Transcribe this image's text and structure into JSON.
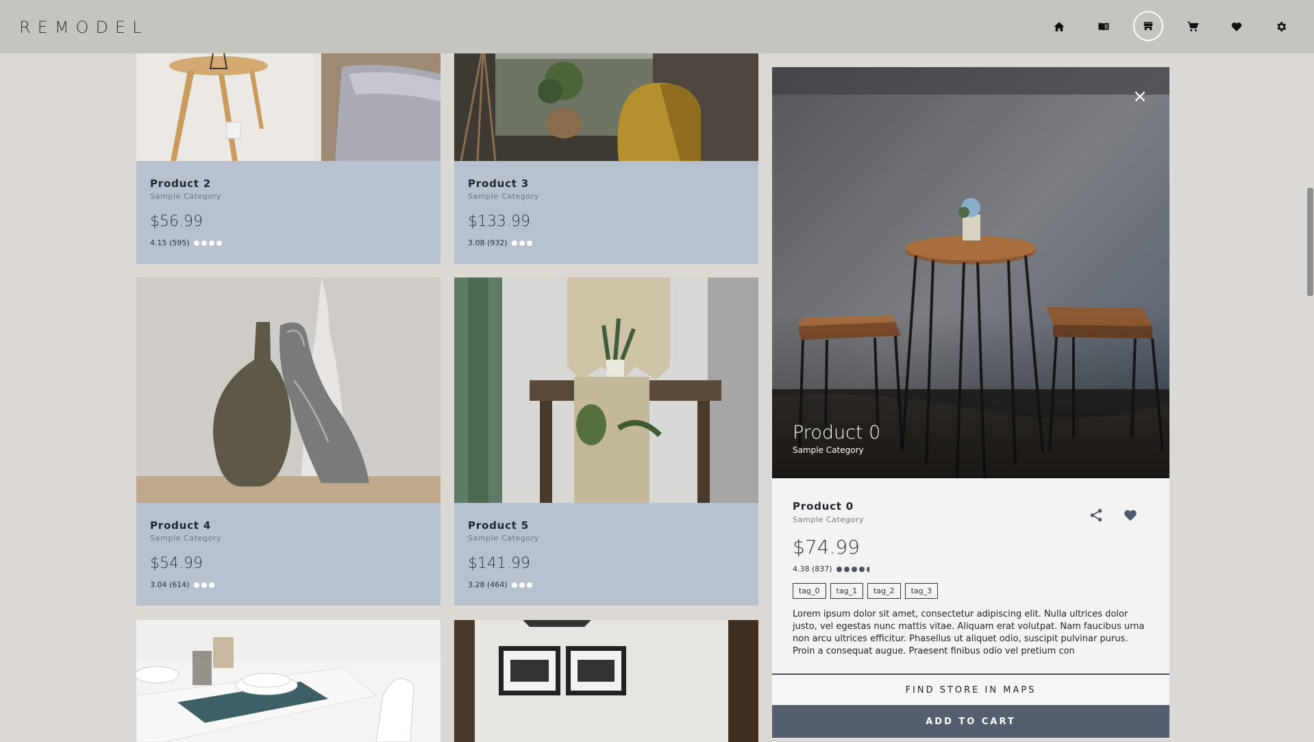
{
  "header": {
    "brand": "REMODEL",
    "nav": [
      {
        "name": "home-icon",
        "active": false
      },
      {
        "name": "book-icon",
        "active": false
      },
      {
        "name": "store-icon",
        "active": true
      },
      {
        "name": "cart-icon",
        "active": false
      },
      {
        "name": "heart-icon",
        "active": false
      },
      {
        "name": "gear-icon",
        "active": false
      }
    ]
  },
  "products": [
    {
      "name": "Product 2",
      "category": "Sample Category",
      "price": "$56.99",
      "rating": "4.15 (595)",
      "dots": 4
    },
    {
      "name": "Product 3",
      "category": "Sample Category",
      "price": "$133.99",
      "rating": "3.08 (932)",
      "dots": 3
    },
    {
      "name": "Product 4",
      "category": "Sample Category",
      "price": "$54.99",
      "rating": "3.04 (614)",
      "dots": 3
    },
    {
      "name": "Product 5",
      "category": "Sample Category",
      "price": "$141.99",
      "rating": "3.28 (464)",
      "dots": 3
    }
  ],
  "detail": {
    "hero_title": "Product 0",
    "hero_category": "Sample Category",
    "name": "Product 0",
    "category": "Sample Category",
    "price": "$74.99",
    "rating": "4.38 (837)",
    "rating_value": 4.38,
    "tags": [
      "tag_0",
      "tag_1",
      "tag_2",
      "tag_3"
    ],
    "description": "Lorem ipsum dolor sit amet, consectetur adipiscing elit. Nulla ultrices dolor justo, vel egestas nunc mattis vitae. Aliquam erat volutpat. Nam faucibus urna non arcu ultrices efficitur. Phasellus ut aliquet odio, suscipit pulvinar purus. Proin a consequat augue. Praesent finibus odio vel pretium con",
    "find_store_label": "FIND STORE IN MAPS",
    "add_to_cart_label": "ADD TO CART",
    "close_label": "×"
  },
  "colors": {
    "background": "#dcd9d4",
    "header": "#c6c4be",
    "card_info": "#b8c1cf",
    "accent": "#555e6e"
  }
}
